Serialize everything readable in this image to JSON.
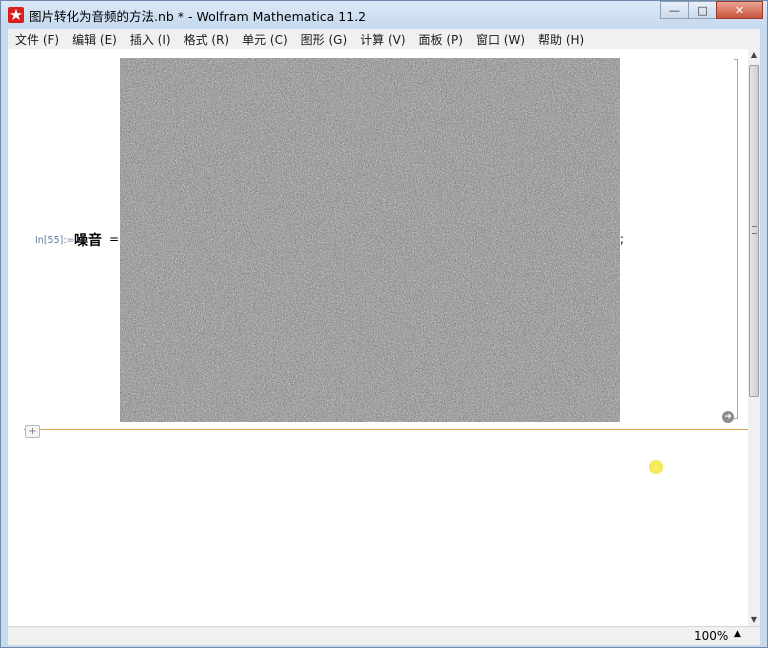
{
  "window": {
    "title": "图片转化为音频的方法.nb * - Wolfram Mathematica 11.2",
    "controls": {
      "minimize_glyph": "—",
      "maximize_glyph": "□",
      "close_glyph": "✕"
    }
  },
  "menubar": {
    "items": [
      {
        "label": "文件 (F)"
      },
      {
        "label": "编辑 (E)"
      },
      {
        "label": "插入 (I)"
      },
      {
        "label": "格式 (R)"
      },
      {
        "label": "单元 (C)"
      },
      {
        "label": "图形 (G)"
      },
      {
        "label": "计算 (V)"
      },
      {
        "label": "面板 (P)"
      },
      {
        "label": "窗口 (W)"
      },
      {
        "label": "帮助 (H)"
      }
    ]
  },
  "notebook": {
    "cell": {
      "label": "In[55]:=",
      "variable": "噪音",
      "equals": "=",
      "terminator": ";",
      "output_image": "random-noise-image"
    },
    "insert_plus": "+"
  },
  "statusbar": {
    "zoom": "100%",
    "zoom_arrow": "▲"
  },
  "colors": {
    "accent": "#d9201f",
    "cell_label": "#5c7fa6",
    "insertion_line": "#d3a34d",
    "cursor_highlight": "#ffee55"
  }
}
